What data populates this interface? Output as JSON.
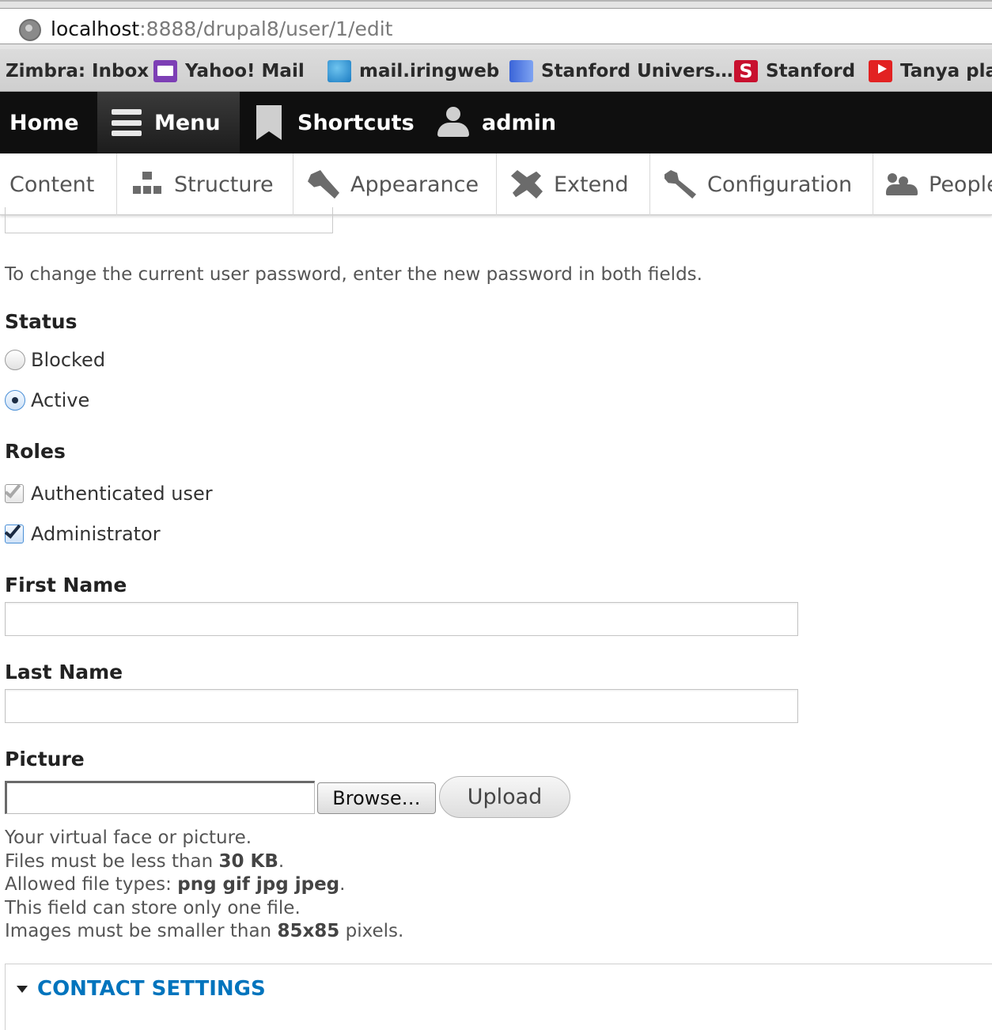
{
  "browser": {
    "url_host": "localhost",
    "url_path": ":8888/drupal8/user/1/edit",
    "bookmarks": [
      {
        "label": "Zimbra: Inbox",
        "icon": "none"
      },
      {
        "label": "Yahoo! Mail",
        "icon": "yahoo-mail-icon"
      },
      {
        "label": "mail.iringweb",
        "icon": "att-globe-icon"
      },
      {
        "label": "Stanford Univers…",
        "icon": "stanford-university-icon"
      },
      {
        "label": "Stanford",
        "icon": "stanford-s-icon"
      },
      {
        "label": "Tanya play",
        "icon": "youtube-icon"
      }
    ]
  },
  "toolbar": {
    "home": "Home",
    "menu": "Menu",
    "shortcuts": "Shortcuts",
    "user": "admin"
  },
  "tray": {
    "items": [
      "Content",
      "Structure",
      "Appearance",
      "Extend",
      "Configuration",
      "People"
    ]
  },
  "form": {
    "password_help": "To change the current user password, enter the new password in both fields.",
    "status": {
      "label": "Status",
      "options": [
        {
          "label": "Blocked",
          "checked": false
        },
        {
          "label": "Active",
          "checked": true
        }
      ]
    },
    "roles": {
      "label": "Roles",
      "options": [
        {
          "label": "Authenticated user",
          "checked": true,
          "disabled": true
        },
        {
          "label": "Administrator",
          "checked": true,
          "disabled": false
        }
      ]
    },
    "first_name": {
      "label": "First Name",
      "value": ""
    },
    "last_name": {
      "label": "Last Name",
      "value": ""
    },
    "picture": {
      "label": "Picture",
      "browse_label": "Browse…",
      "upload_label": "Upload",
      "help": {
        "line1": "Your virtual face or picture.",
        "line2_prefix": "Files must be less than ",
        "line2_value": "30 KB",
        "line2_suffix": ".",
        "line3_prefix": "Allowed file types: ",
        "line3_value": "png gif jpg jpeg",
        "line3_suffix": ".",
        "line4": "This field can store only one file.",
        "line5_prefix": "Images must be smaller than ",
        "line5_value": "85x85",
        "line5_suffix": " pixels."
      }
    },
    "contact_settings": {
      "label": "CONTACT SETTINGS"
    }
  },
  "colors": {
    "toolbar_bg": "#0f0f0f",
    "link_blue": "#0074bd"
  }
}
